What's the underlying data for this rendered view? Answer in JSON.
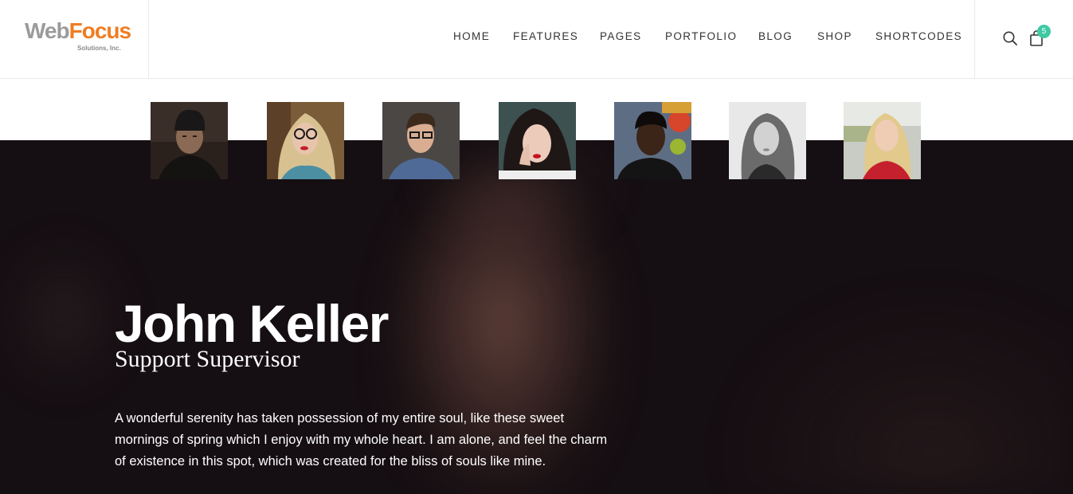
{
  "logo": {
    "main_left": "Web",
    "main_right": "Focus",
    "sub": "Solutions, Inc."
  },
  "nav": {
    "items": [
      "HOME",
      "FEATURES",
      "PAGES",
      "PORTFOLIO",
      "BLOG",
      "SHOP",
      "SHORTCODES"
    ]
  },
  "cart": {
    "count": "5"
  },
  "team": {
    "members": [
      {
        "icon": "portrait-man-beanie"
      },
      {
        "icon": "portrait-woman-glasses"
      },
      {
        "icon": "portrait-man-glasses"
      },
      {
        "icon": "portrait-woman-dark-hair"
      },
      {
        "icon": "portrait-man-graffiti"
      },
      {
        "icon": "portrait-woman-grayscale"
      },
      {
        "icon": "portrait-woman-blonde"
      }
    ]
  },
  "profile": {
    "name": "John Keller",
    "role": "Support Supervisor",
    "bio": "A wonderful serenity has taken possession of my entire soul, like these sweet mornings of spring which I enjoy with my whole heart. I am alone, and feel the charm of existence in this spot, which was created for the bliss of souls like mine."
  },
  "colors": {
    "accent": "#3fc9a4",
    "logo_orange": "#ef7d22",
    "hero_bg": "#150e12"
  }
}
